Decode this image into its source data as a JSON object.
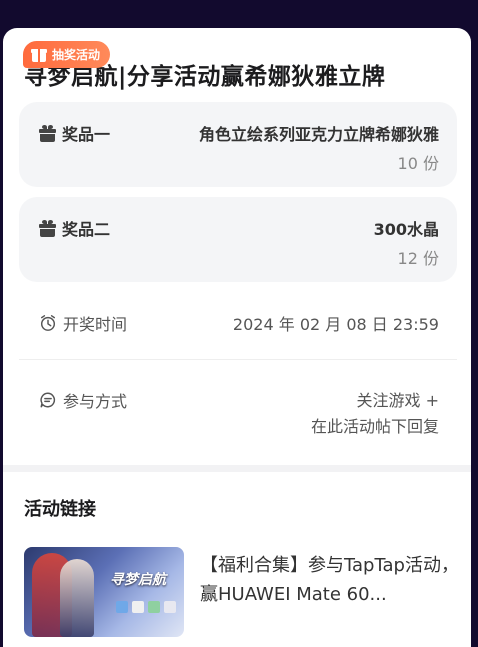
{
  "badge": {
    "label": "抽奖活动",
    "icon": "gift-box-icon",
    "color": "#ff6a3d"
  },
  "title": "寻梦启航|分享活动赢希娜狄雅立牌",
  "prizes": [
    {
      "label": "奖品一",
      "icon": "gift-icon",
      "name": "角色立绘系列亚克力立牌希娜狄雅",
      "quantity": "10 份"
    },
    {
      "label": "奖品二",
      "icon": "gift-icon",
      "name": "300水晶",
      "quantity": "12 份"
    }
  ],
  "draw_time": {
    "label": "开奖时间",
    "icon": "alarm-clock-icon",
    "value": "2024 年 02 月 08 日 23:59"
  },
  "participation": {
    "label": "参与方式",
    "icon": "chat-bubble-icon",
    "value_line1": "关注游戏 +",
    "value_line2": "在此活动帖下回复"
  },
  "links_section": {
    "title": "活动链接",
    "items": [
      {
        "thumbnail_text": "寻梦启航",
        "text": "【福利合集】参与TapTap活动，赢HUAWEI Mate 60..."
      }
    ]
  },
  "colors": {
    "page_background": "#120a2e",
    "card_background": "#f4f5f7",
    "accent": "#ff6a3d"
  }
}
